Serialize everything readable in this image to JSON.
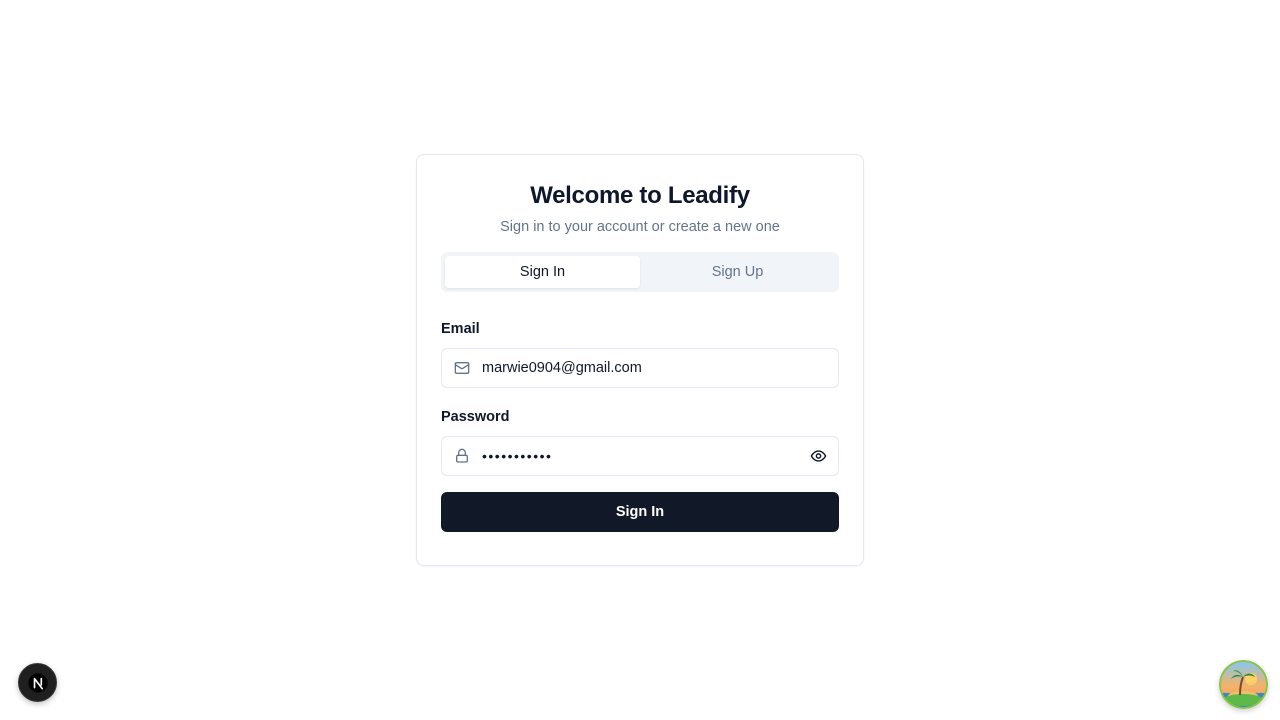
{
  "header": {
    "title": "Welcome to Leadify",
    "subtitle": "Sign in to your account or create a new one"
  },
  "tabs": [
    {
      "label": "Sign In",
      "active": true
    },
    {
      "label": "Sign Up",
      "active": false
    }
  ],
  "form": {
    "email_label": "Email",
    "email_value": "marwie0904@gmail.com",
    "password_label": "Password",
    "password_value": "•••••••••••",
    "submit_label": "Sign In"
  },
  "icons": {
    "email": "mail-icon",
    "password": "lock-icon",
    "toggle_visibility": "eye-icon",
    "dev_badge": "nextjs-logo-icon",
    "floating": "island-avatar-icon"
  },
  "colors": {
    "primary": "#111827",
    "muted_text": "#64748b",
    "border": "#e2e8f0",
    "tab_bg": "#f1f5f9"
  }
}
